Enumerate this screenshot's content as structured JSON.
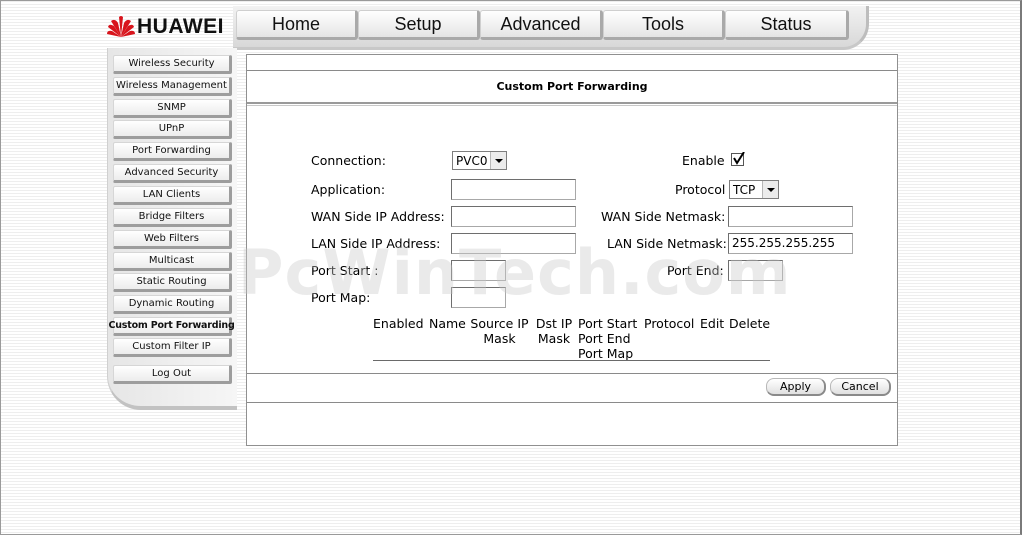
{
  "brand": {
    "name": "HUAWEI",
    "logo_color": "#d8141c"
  },
  "topnav": [
    "Home",
    "Setup",
    "Advanced",
    "Tools",
    "Status"
  ],
  "sidebar": [
    "Wireless Security",
    "Wireless Management",
    "SNMP",
    "UPnP",
    "Port Forwarding",
    "Advanced Security",
    "LAN Clients",
    "Bridge Filters",
    "Web Filters",
    "Multicast",
    "Static Routing",
    "Dynamic Routing",
    "Custom Port Forwarding",
    "Custom Filter IP",
    "Log Out"
  ],
  "page_title": "Custom Port Forwarding",
  "form": {
    "connection_label": "Connection:",
    "connection_value": "PVC0",
    "enable_label": "Enable",
    "enable_checked": true,
    "application_label": "Application:",
    "application_value": "",
    "protocol_label": "Protocol",
    "protocol_value": "TCP",
    "wan_ip_label": "WAN Side IP Address:",
    "wan_ip_value": "",
    "wan_mask_label": "WAN Side Netmask:",
    "wan_mask_value": "",
    "lan_ip_label": "LAN Side IP Address:",
    "lan_ip_value": "",
    "lan_mask_label": "LAN Side Netmask:",
    "lan_mask_value": "255.255.255.255",
    "port_start_label": "Port Start :",
    "port_start_value": "",
    "port_end_label": "Port End:",
    "port_end_value": "",
    "port_map_label": "Port Map:",
    "port_map_value": ""
  },
  "table": {
    "col_enabled": "Enabled",
    "col_name": "Name",
    "col_source_ip": "Source IP",
    "col_source_mask": "Mask",
    "col_dst_ip": "Dst IP",
    "col_dst_mask": "Mask",
    "col_port_start": "Port Start",
    "col_port_end": "Port End",
    "col_port_map": "Port Map",
    "col_protocol": "Protocol",
    "col_edit": "Edit",
    "col_delete": "Delete"
  },
  "buttons": {
    "apply": "Apply",
    "cancel": "Cancel"
  },
  "watermark": "PcWinTech.com"
}
